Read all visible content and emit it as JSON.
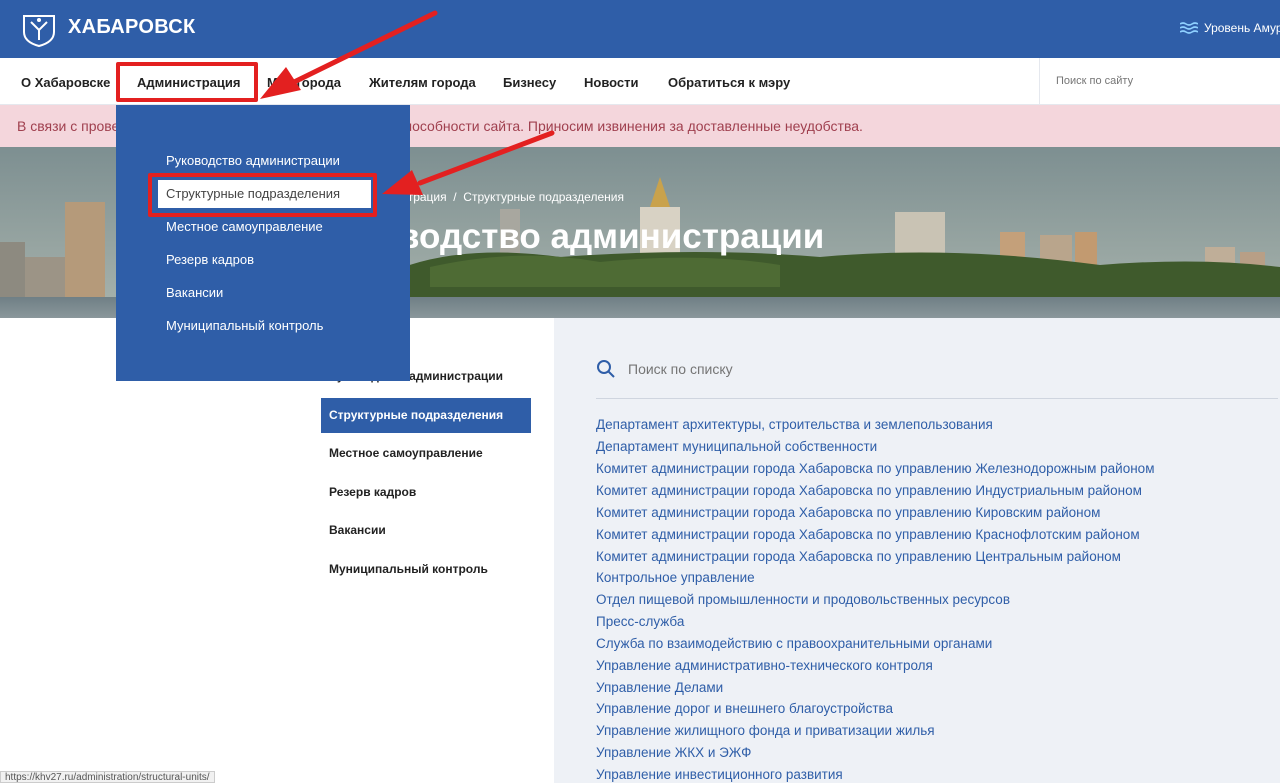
{
  "header": {
    "site_title": "ХАБАРОВСК",
    "amur_label": "Уровень Амура"
  },
  "nav": {
    "items": [
      {
        "label": "О Хабаровске"
      },
      {
        "label": "Администрация"
      },
      {
        "label": "Мэр города"
      },
      {
        "label": "Жителям города"
      },
      {
        "label": "Бизнесу"
      },
      {
        "label": "Новости"
      },
      {
        "label": "Обратиться к мэру"
      }
    ],
    "search_placeholder": "Поиск по сайту"
  },
  "alert": {
    "text": "В связи с прове                                                      и в работоспособности сайта. Приносим извинения за доставленные неудобства."
  },
  "hero": {
    "breadcrumb": "истрация  /  Структурные подразделения",
    "title": "водство администрации"
  },
  "dropdown": {
    "items": [
      {
        "label": "Руководство администрации"
      },
      {
        "label": "Структурные подразделения"
      },
      {
        "label": "Местное самоуправление"
      },
      {
        "label": "Резерв кадров"
      },
      {
        "label": "Вакансии"
      },
      {
        "label": "Муниципальный контроль"
      }
    ]
  },
  "sidebar": {
    "items": [
      {
        "label": "Руководство администрации"
      },
      {
        "label": "Структурные подразделения"
      },
      {
        "label": "Местное самоуправление"
      },
      {
        "label": "Резерв кадров"
      },
      {
        "label": "Вакансии"
      },
      {
        "label": "Муниципальный контроль"
      }
    ],
    "active_index": 1
  },
  "main": {
    "search_placeholder": "Поиск по списку",
    "links": [
      "Департамент архитектуры, строительства и землепользования",
      "Департамент муниципальной собственности",
      "Комитет администрации города Хабаровска по управлению Железнодорожным районом",
      "Комитет администрации города Хабаровска по управлению Индустриальным районом",
      "Комитет администрации города Хабаровска по управлению Кировским районом",
      "Комитет администрации города Хабаровска по управлению Краснофлотским районом",
      "Комитет администрации города Хабаровска по управлению Центральным районом",
      "Контрольное управление",
      "Отдел пищевой промышленности и продовольственных ресурсов",
      "Пресс-служба",
      "Служба по взаимодействию с правоохранительными органами",
      "Управление административно-технического контроля",
      "Управление Делами",
      "Управление дорог и внешнего благоустройства",
      "Управление жилищного фонда и приватизации жилья",
      "Управление ЖКХ и ЭЖФ",
      "Управление инвестиционного развития"
    ]
  },
  "status_bar": {
    "url": "https://khv27.ru/administration/structural-units/"
  },
  "colors": {
    "brand_blue": "#2f5ea8",
    "alert_bg": "#f4d6dc",
    "alert_text": "#a0404f",
    "annotation_red": "#e32020",
    "panel_bg": "#eef1f6"
  }
}
